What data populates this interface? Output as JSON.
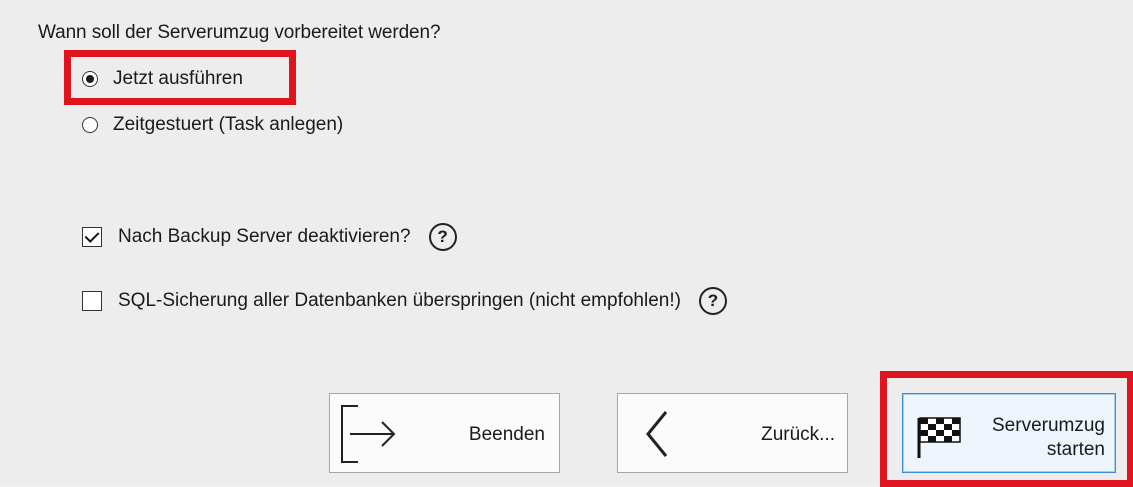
{
  "question": "Wann soll der Serverumzug vorbereitet werden?",
  "options": [
    {
      "label": "Jetzt ausführen",
      "selected": true
    },
    {
      "label": "Zeitgestuert (Task anlegen)",
      "selected": false
    }
  ],
  "checkboxes": [
    {
      "label": "Nach Backup Server deaktivieren?",
      "checked": true,
      "help_icon": "help-icon",
      "help_glyph": "?"
    },
    {
      "label": "SQL-Sicherung aller Datenbanken überspringen (nicht empfohlen!)",
      "checked": false,
      "help_icon": "help-icon",
      "help_glyph": "?"
    }
  ],
  "buttons": {
    "exit": {
      "label": "Beenden",
      "icon": "exit-door-arrow-icon"
    },
    "back": {
      "label": "Zurück...",
      "icon": "chevron-left-icon"
    },
    "start": {
      "label_line1": "Serverumzug",
      "label_line2": "starten",
      "icon": "checkered-flag-icon"
    }
  },
  "colors": {
    "highlight": "#e0141e",
    "default_button_border": "#3c8bd9"
  }
}
